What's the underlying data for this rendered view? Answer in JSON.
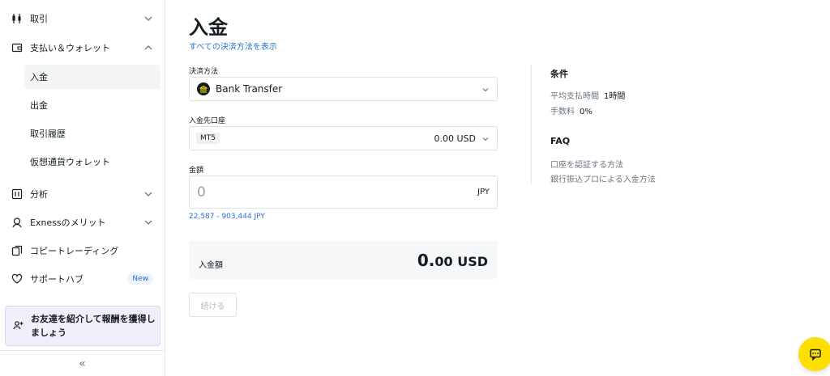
{
  "sidebar": {
    "items": [
      {
        "label": "取引"
      },
      {
        "label": "支払い＆ウォレット"
      },
      {
        "label": "分析"
      },
      {
        "label": "Exnessのメリット"
      },
      {
        "label": "コピートレーディング"
      },
      {
        "label": "サポートハブ",
        "badge": "New"
      }
    ],
    "sub_items": [
      {
        "label": "入金",
        "active": true
      },
      {
        "label": "出金"
      },
      {
        "label": "取引履歴"
      },
      {
        "label": "仮想通貨ウォレット"
      }
    ],
    "promo": "お友達を紹介して報酬を獲得しましょう",
    "collapse": "«"
  },
  "main": {
    "title": "入金",
    "show_all_link": "すべての決済方法を表示",
    "payment_method": {
      "label": "決済方法",
      "value": "Bank Transfer"
    },
    "account": {
      "label": "入金先口座",
      "tag": "MT5",
      "balance": "0.00 USD"
    },
    "amount": {
      "label": "金額",
      "placeholder": "0",
      "currency": "JPY",
      "range": "22,587 - 903,444 JPY"
    },
    "summary": {
      "label": "入金額",
      "amount_int": "0.",
      "amount_dec": "00 USD"
    },
    "continue_button": "続ける"
  },
  "conditions": {
    "title": "条件",
    "rows": [
      {
        "label": "平均支払時間",
        "value": "1時間"
      },
      {
        "label": "手数料",
        "value": "0%"
      }
    ]
  },
  "faq": {
    "title": "FAQ",
    "links": [
      "口座を認証する方法",
      "銀行振込プロによる入金方法"
    ]
  },
  "colors": {
    "accent": "#2a74c8",
    "chat_button": "#ffde02",
    "promo_bg": "#f2edfb"
  }
}
